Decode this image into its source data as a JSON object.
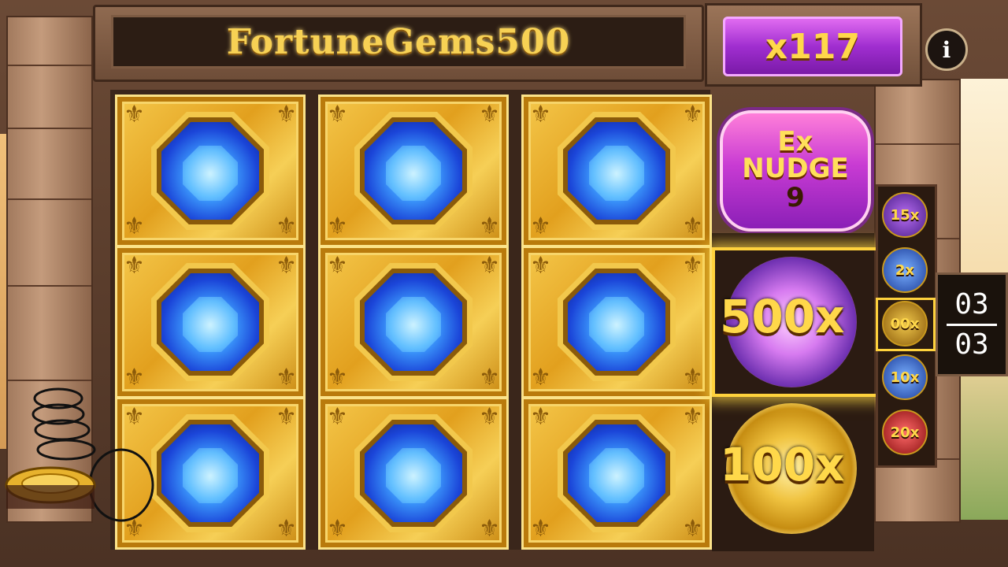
{
  "game": {
    "title": "FortuneGems500"
  },
  "multiplier": {
    "value": "x117"
  },
  "info": {
    "label": "i"
  },
  "nudge": {
    "line1": "Ex",
    "line2": "NUDGE",
    "count": "9"
  },
  "wheel": {
    "top_label": "500x",
    "bottom_label": "100x"
  },
  "mini_multipliers": [
    "15x",
    "2x",
    "00x",
    "10x",
    "20x"
  ],
  "counter": {
    "top": "03",
    "bottom": "03"
  },
  "reels": {
    "rows": 3,
    "cols": 3,
    "symbol": "blue-gem"
  },
  "colors": {
    "gold": "#f5c84b",
    "gem_blue": "#1b45d8",
    "purple": "#a02ed0",
    "text_gold": "#ffd84a"
  }
}
